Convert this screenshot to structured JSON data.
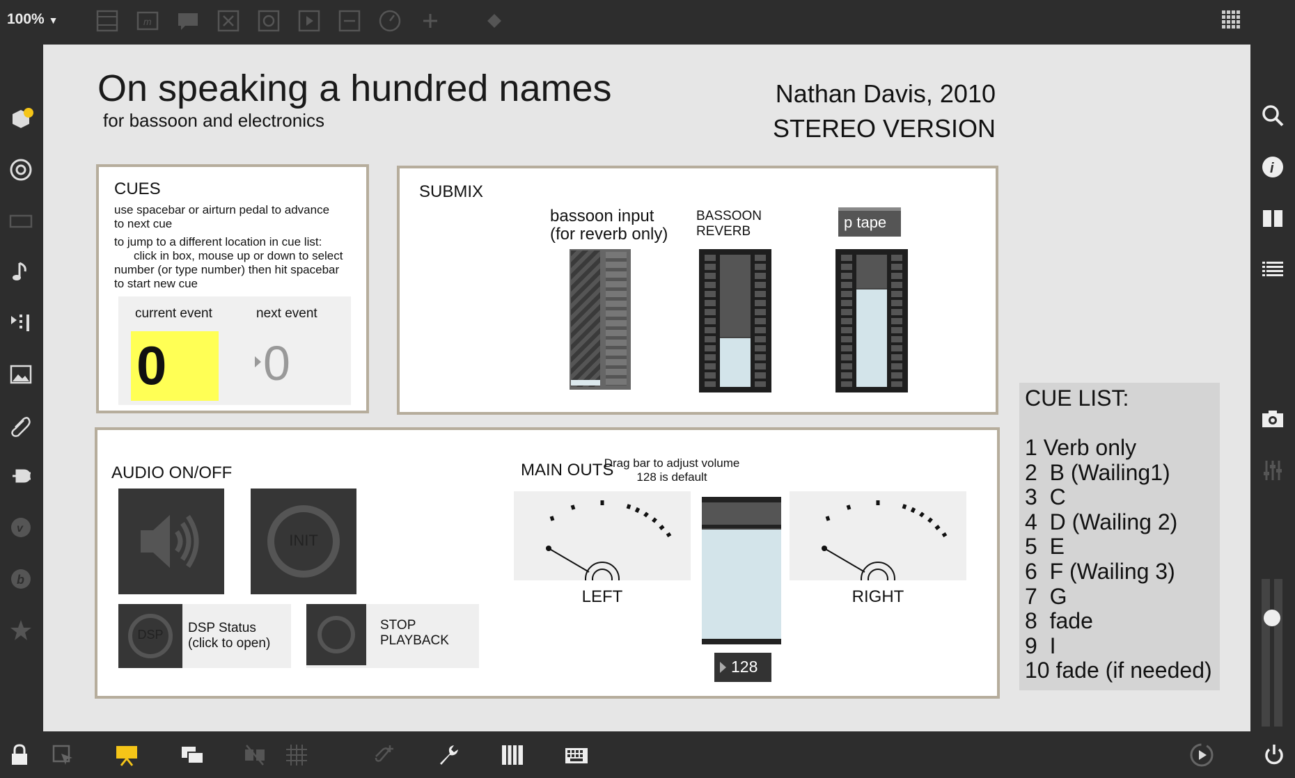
{
  "toolbar": {
    "zoom": "100%",
    "icons": [
      "layout-icon",
      "comment-m-icon",
      "speech-bubble-icon",
      "x-box-icon",
      "circle-button-icon",
      "play-box-icon",
      "slider-box-icon",
      "dial-icon",
      "plus-icon",
      "paint-bucket-icon",
      "grid-icon"
    ]
  },
  "left_bar": {
    "icons": [
      "cube-icon",
      "target-icon",
      "keyboard-icon",
      "music-note-icon",
      "playlist-icon",
      "image-icon",
      "paperclip-icon",
      "plug-icon",
      "v-circle-icon",
      "b-circle-icon",
      "star-icon"
    ]
  },
  "right_bar": {
    "icons": [
      "search-icon",
      "info-icon",
      "columns-icon",
      "list-icon",
      "camera-icon",
      "mixer-icon"
    ]
  },
  "bottom_bar": {
    "icons": [
      "lock-icon",
      "select-arrow-icon",
      "presentation-icon",
      "windows-icon",
      "mute-icon",
      "grid-icon",
      "paperclip-plus-icon",
      "wrench-icon",
      "piano-icon",
      "keyboard-icon",
      "play-circle-icon",
      "power-icon"
    ]
  },
  "header": {
    "title": "On speaking a hundred names",
    "subtitle": "for bassoon and electronics",
    "composer": "Nathan Davis, 2010",
    "version": "STEREO VERSION"
  },
  "cues": {
    "heading": "CUES",
    "line1": "use spacebar or airturn pedal to advance",
    "line2": "to next cue",
    "line3": "to jump to a different location in cue list:",
    "line4": "click in box, mouse up or down to select",
    "line5": "number (or type number)  then hit spacebar",
    "line6": "to start new cue",
    "current_label": "current event",
    "next_label": "next event",
    "current_value": "0",
    "next_value": "0",
    "highlight_color": "#ffff55"
  },
  "submix": {
    "heading": "SUBMIX",
    "bassoon_input_line1": "bassoon input",
    "bassoon_input_line2": "(for reverb only)",
    "reverb_line1": "BASSOON",
    "reverb_line2": "REVERB",
    "tape_label": "p tape",
    "reverb_level": 0.38,
    "tape_level": 0.75
  },
  "audio": {
    "heading": "AUDIO ON/OFF",
    "init_label": "INIT",
    "dsp_label": "DSP",
    "dsp_status_line1": "DSP Status",
    "dsp_status_line2": "(click to open)",
    "stop_line1": "STOP",
    "stop_line2": "PLAYBACK"
  },
  "main_outs": {
    "heading": "MAIN OUTS",
    "hint_line1": "Drag bar to adjust volume",
    "hint_line2": "128 is default",
    "left_label": "LEFT",
    "right_label": "RIGHT",
    "volume_value": "128"
  },
  "cue_list": {
    "heading": "CUE LIST:",
    "items": [
      "1 Verb only",
      "2  B (Wailing1)",
      "3  C",
      "4  D (Wailing 2)",
      "5  E",
      "6  F (Wailing 3)",
      "7  G",
      "8  fade",
      "9  I",
      "10 fade (if needed)"
    ]
  }
}
